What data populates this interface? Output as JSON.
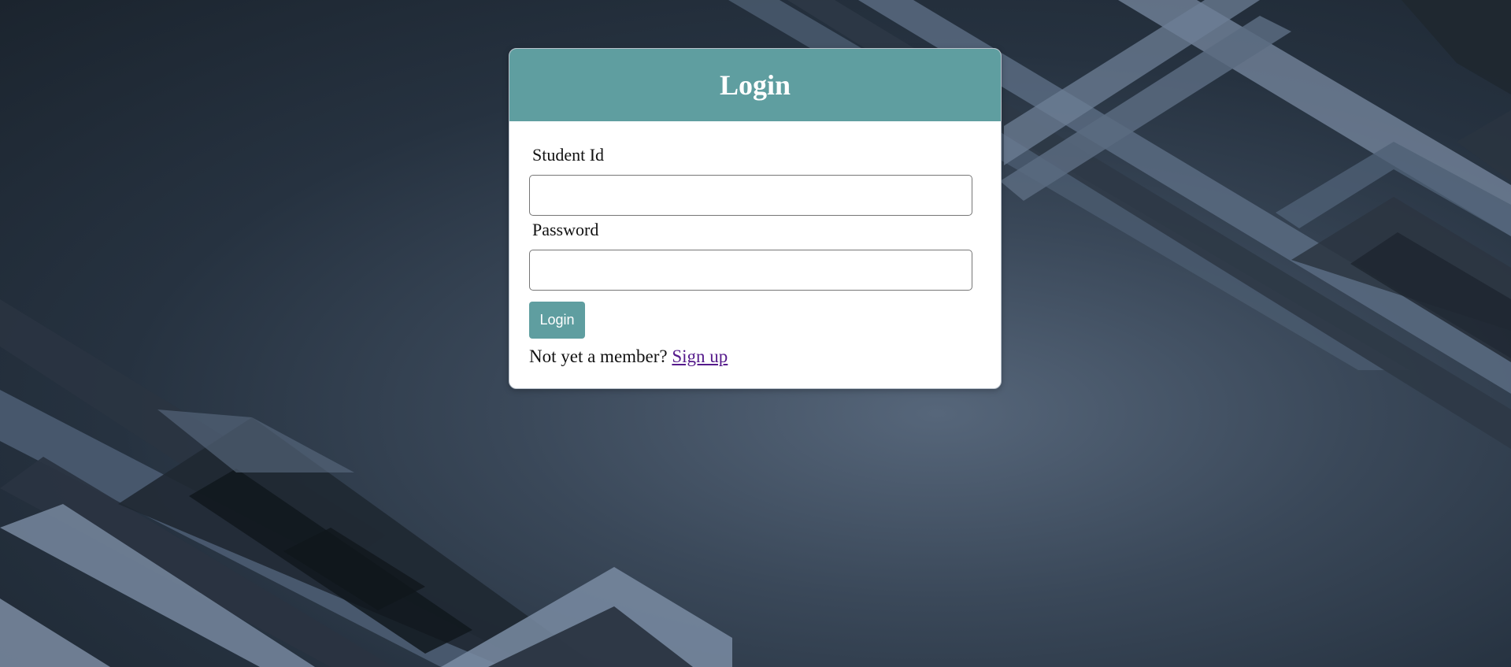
{
  "login_card": {
    "title": "Login",
    "student_id": {
      "label": "Student Id",
      "value": "",
      "placeholder": ""
    },
    "password": {
      "label": "Password",
      "value": "",
      "placeholder": ""
    },
    "submit_label": "Login",
    "signup_prompt": "Not yet a member?",
    "signup_link": "Sign up"
  },
  "colors": {
    "header_bg": "#5f9ea0",
    "button_bg": "#5f9ea0",
    "link": "#551a8b",
    "page_bg_dark": "#1b242e",
    "page_bg_light": "#56667a"
  }
}
